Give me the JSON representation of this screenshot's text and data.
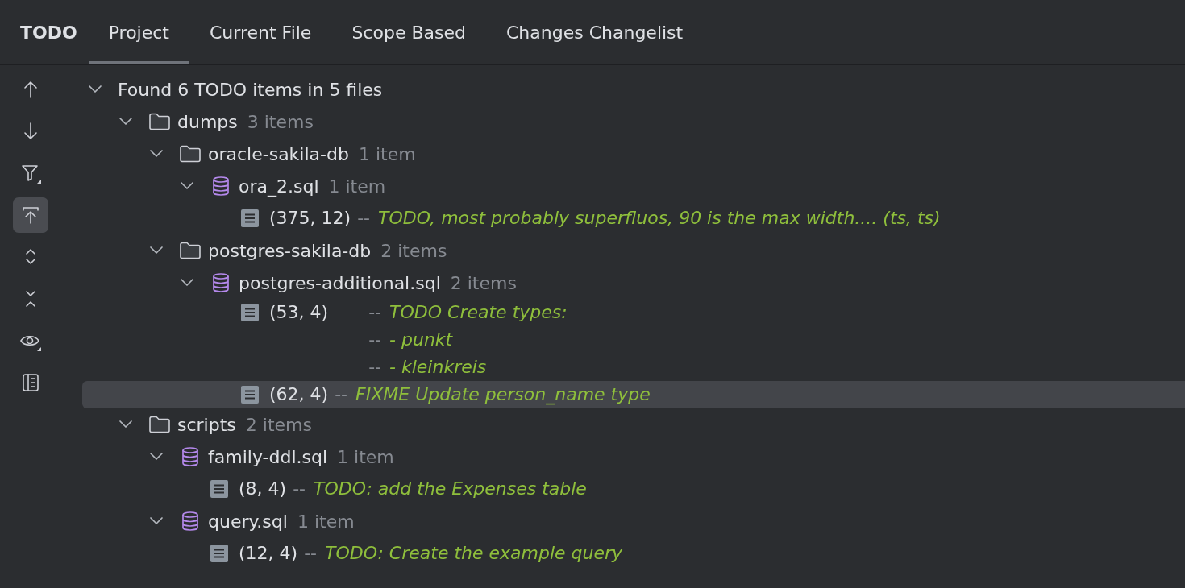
{
  "panel_title": "TODO",
  "tabs": [
    {
      "label": "Project",
      "selected": true
    },
    {
      "label": "Current File",
      "selected": false
    },
    {
      "label": "Scope Based",
      "selected": false
    },
    {
      "label": "Changes Changelist",
      "selected": false
    }
  ],
  "toolbar": [
    {
      "kind": "up",
      "selected": false
    },
    {
      "kind": "down",
      "selected": false
    },
    {
      "kind": "filter",
      "selected": false
    },
    {
      "kind": "autoscroll",
      "selected": true
    },
    {
      "kind": "expand",
      "selected": false
    },
    {
      "kind": "collapse",
      "selected": false
    },
    {
      "kind": "preview",
      "selected": false
    },
    {
      "kind": "layout",
      "selected": false
    }
  ],
  "tree": {
    "kind": "root",
    "label": "Found 6 TODO items in 5 files",
    "expanded": true,
    "selected": false,
    "children": [
      {
        "kind": "folder",
        "label": "dumps",
        "count": "3 items",
        "expanded": true,
        "selected": false,
        "children": [
          {
            "kind": "folder",
            "label": "oracle-sakila-db",
            "count": "1 item",
            "expanded": true,
            "selected": false,
            "children": [
              {
                "kind": "file",
                "label": "ora_2.sql",
                "count": "1 item",
                "expanded": true,
                "selected": false,
                "children": [
                  {
                    "kind": "todo",
                    "position": "(375, 12)",
                    "selected": false,
                    "lines": [
                      {
                        "dash": "--",
                        "text": "TODO, most probably superfluos, 90 is the max width.... (ts, ts)"
                      }
                    ]
                  }
                ]
              }
            ]
          },
          {
            "kind": "folder",
            "label": "postgres-sakila-db",
            "count": "2 items",
            "expanded": true,
            "selected": false,
            "children": [
              {
                "kind": "file",
                "label": "postgres-additional.sql",
                "count": "2 items",
                "expanded": true,
                "selected": false,
                "children": [
                  {
                    "kind": "todo",
                    "position": "(53, 4)",
                    "selected": false,
                    "lines": [
                      {
                        "dash": "--",
                        "text": "TODO Create types:"
                      },
                      {
                        "dash": "--",
                        "text": "- punkt"
                      },
                      {
                        "dash": "--",
                        "text": "- kleinkreis"
                      }
                    ]
                  },
                  {
                    "kind": "todo",
                    "position": "(62, 4)",
                    "selected": true,
                    "lines": [
                      {
                        "dash": "--",
                        "text": "FIXME Update person_name type"
                      }
                    ]
                  }
                ]
              }
            ]
          }
        ]
      },
      {
        "kind": "folder",
        "label": "scripts",
        "count": "2 items",
        "expanded": true,
        "selected": false,
        "children": [
          {
            "kind": "file",
            "label": "family-ddl.sql",
            "count": "1 item",
            "expanded": true,
            "selected": false,
            "children": [
              {
                "kind": "todo",
                "position": "(8, 4)",
                "selected": false,
                "lines": [
                  {
                    "dash": "--",
                    "text": "TODO: add the Expenses table"
                  }
                ]
              }
            ]
          },
          {
            "kind": "file",
            "label": "query.sql",
            "count": "1 item",
            "expanded": true,
            "selected": false,
            "children": [
              {
                "kind": "todo",
                "position": "(12, 4)",
                "selected": false,
                "lines": [
                  {
                    "dash": "--",
                    "text": "TODO: Create the example query"
                  }
                ]
              }
            ]
          }
        ]
      }
    ]
  }
}
